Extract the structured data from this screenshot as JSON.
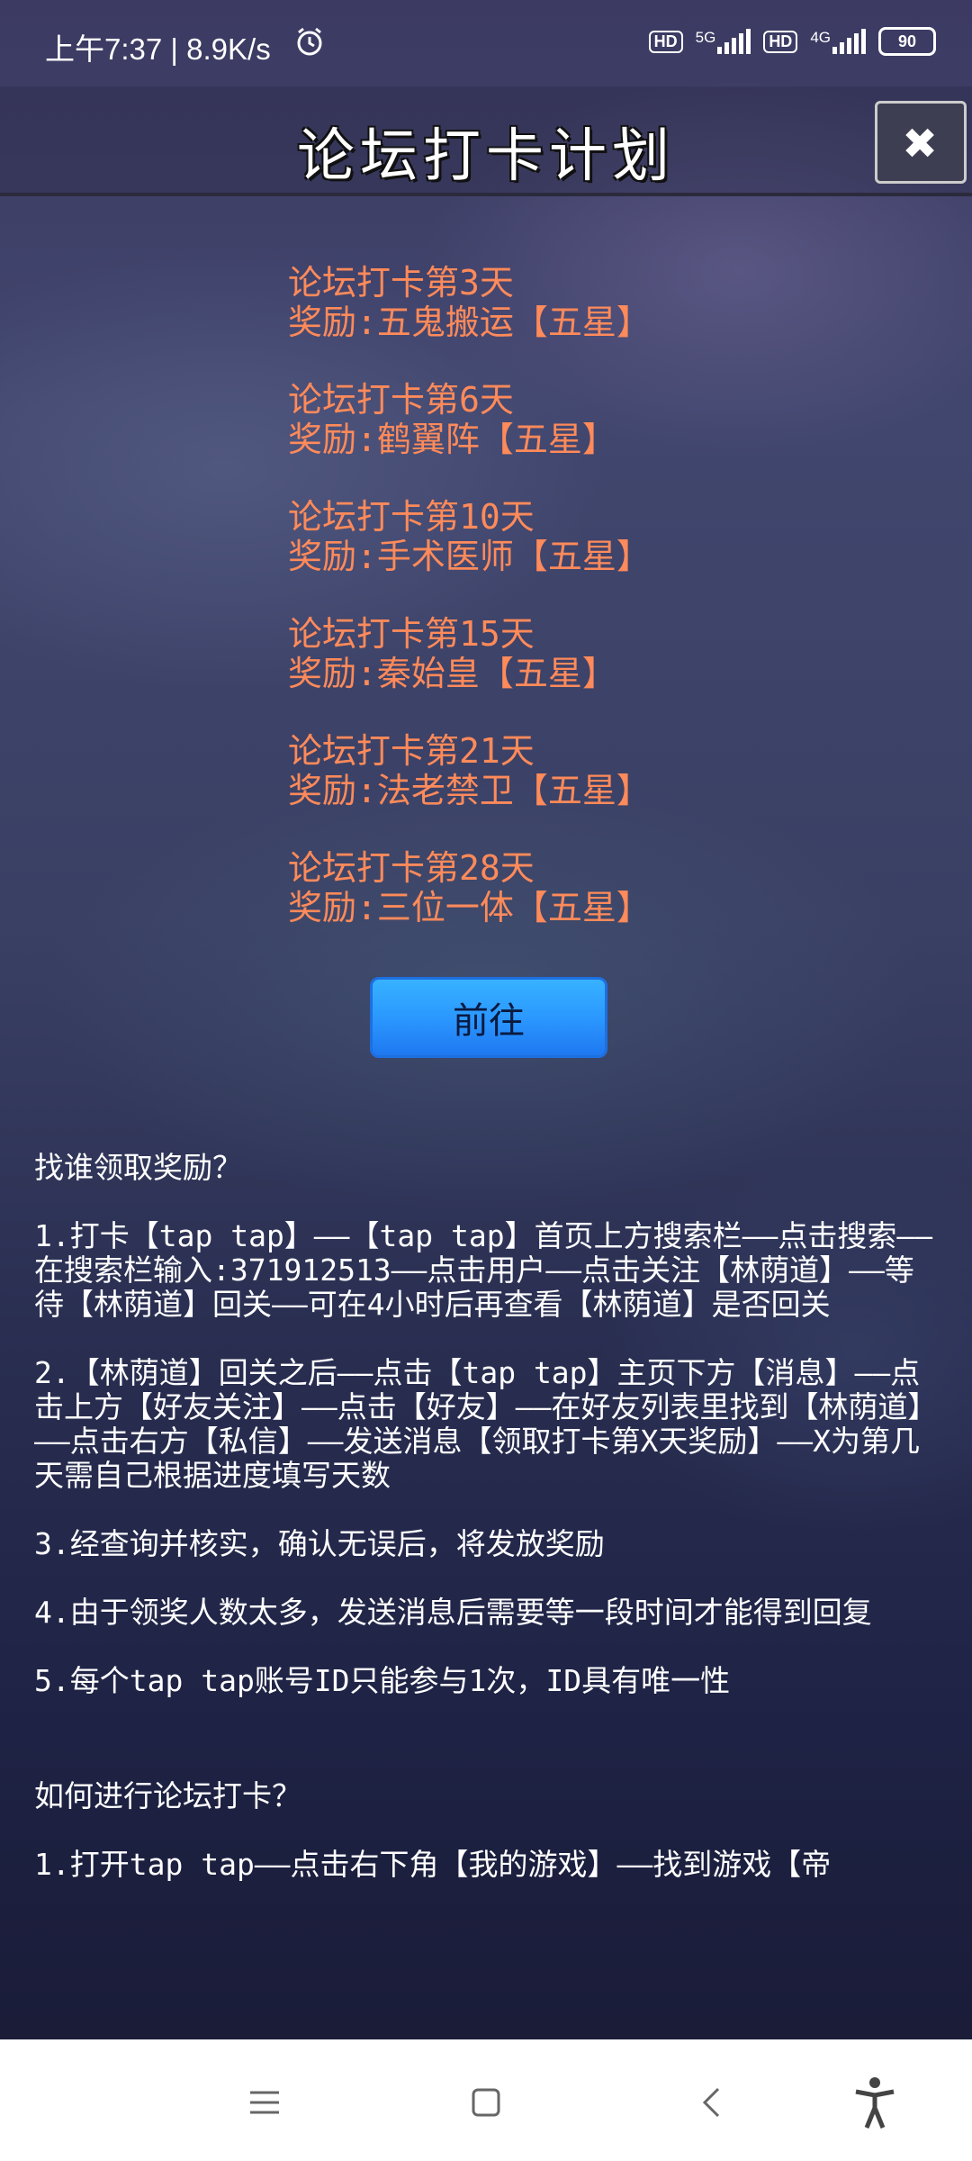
{
  "status_bar": {
    "time": "上午7:37 | 8.9K/s",
    "alarm_icon": "alarm-icon",
    "hd1": "HD",
    "net1": "5G",
    "hd2": "HD",
    "net2": "4G",
    "battery": "90"
  },
  "header": {
    "title": "论坛打卡计划",
    "close_icon": "close-icon"
  },
  "rewards": [
    {
      "day": "论坛打卡第3天",
      "reward": "奖励:五鬼搬运【五星】"
    },
    {
      "day": "论坛打卡第6天",
      "reward": "奖励:鹤翼阵【五星】"
    },
    {
      "day": "论坛打卡第10天",
      "reward": "奖励:手术医师【五星】"
    },
    {
      "day": "论坛打卡第15天",
      "reward": "奖励:秦始皇【五星】"
    },
    {
      "day": "论坛打卡第21天",
      "reward": "奖励:法老禁卫【五星】"
    },
    {
      "day": "论坛打卡第28天",
      "reward": "奖励:三位一体【五星】"
    }
  ],
  "go_button": "前往",
  "info": {
    "heading1": "找谁领取奖励？",
    "step1": "1.打卡【tap tap】——【tap tap】首页上方搜索栏——点击搜索——在搜索栏输入:371912513——点击用户——点击关注【林荫道】——等待【林荫道】回关——可在4小时后再查看【林荫道】是否回关",
    "step2": "2.【林荫道】回关之后——点击【tap tap】主页下方【消息】——点击上方【好友关注】——点击【好友】——在好友列表里找到【林荫道】——点击右方【私信】——发送消息【领取打卡第X天奖励】——X为第几天需自己根据进度填写天数",
    "step3": "3.经查询并核实，确认无误后，将发放奖励",
    "step4": "4.由于领奖人数太多，发送消息后需要等一段时间才能得到回复",
    "step5": "5.每个tap tap账号ID只能参与1次，ID具有唯一性",
    "heading2": "如何进行论坛打卡？",
    "step6": "1.打开tap tap——点击右下角【我的游戏】——找到游戏【帝"
  },
  "navbar": {
    "menu_icon": "menu-icon",
    "home_icon": "home-icon",
    "back_icon": "back-icon",
    "accessibility_icon": "accessibility-icon"
  }
}
